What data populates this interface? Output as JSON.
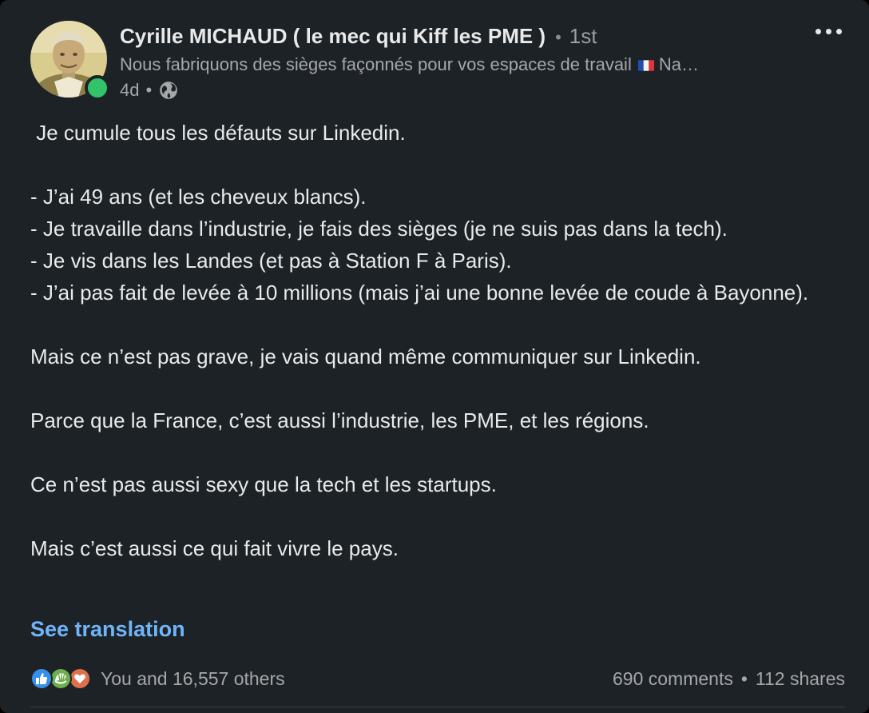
{
  "author": {
    "name": "Cyrille MICHAUD ( le mec qui Kiff les PME )",
    "separator": "•",
    "degree": "1st",
    "headline_before_flag": "Nous fabriquons des sièges façonnés pour vos espaces de travail",
    "headline_after_flag": "Na…",
    "timestamp": "4d",
    "meta_separator": "•",
    "avatar_icon": "avatar-photo",
    "presence_color": "#32c36b",
    "flag_icon": "france-flag-icon",
    "visibility_icon": "globe-icon"
  },
  "post": {
    "lines": [
      " Je cumule tous les défauts sur Linkedin.",
      "",
      "- J’ai 49 ans (et les cheveux blancs).",
      "- Je travaille dans l’industrie, je fais des sièges (je ne suis pas dans la tech).",
      "- Je vis dans les Landes (et pas à Station F à Paris).",
      "- J’ai pas fait de levée à 10 millions (mais j’ai une bonne levée de coude à Bayonne).",
      "",
      "Mais ce n’est pas grave, je vais quand même communiquer sur Linkedin.",
      "",
      "Parce que la France, c’est aussi l’industrie, les PME, et les régions.",
      "",
      "Ce n’est pas aussi sexy que la tech et les startups.",
      "",
      "Mais c’est aussi ce qui fait vivre le pays."
    ],
    "see_translation": "See translation"
  },
  "social": {
    "reaction_icons": [
      "like-reaction-icon",
      "support-reaction-icon",
      "love-reaction-icon"
    ],
    "reactions_text": "You and 16,557 others",
    "comments": "690 comments",
    "separator": "•",
    "shares": "112 shares"
  },
  "colors": {
    "background": "#1d2226",
    "text": "#e9eaea",
    "muted": "#a6a7a9",
    "link": "#70b5f9",
    "like": "#378fe9",
    "support": "#6dae4f",
    "love": "#df704d"
  }
}
